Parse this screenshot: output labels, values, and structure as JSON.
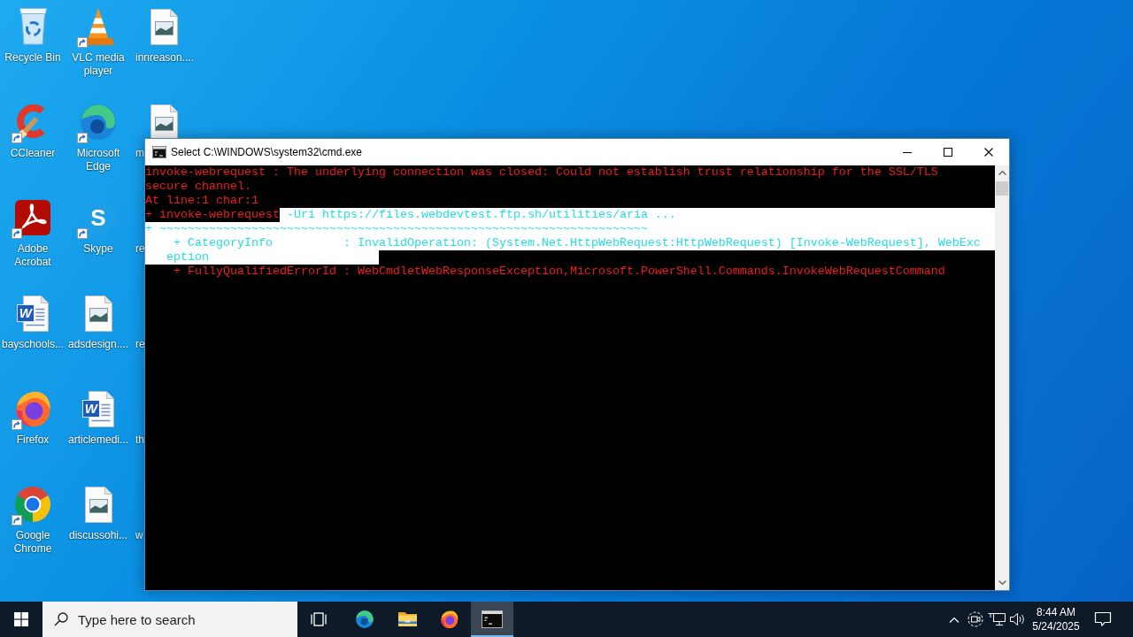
{
  "desktop_columns": [
    {
      "icons": [
        {
          "label": "Recycle Bin",
          "kind": "recycle-bin",
          "shortcut": false
        },
        {
          "label": "CCleaner",
          "kind": "ccleaner",
          "shortcut": true
        },
        {
          "label": "Adobe Acrobat",
          "kind": "acrobat",
          "shortcut": true
        },
        {
          "label": "bayschools...",
          "kind": "word-document",
          "glyph": "W",
          "shortcut": false
        },
        {
          "label": "Firefox",
          "kind": "firefox",
          "shortcut": true
        },
        {
          "label": "Google Chrome",
          "kind": "chrome",
          "shortcut": true
        }
      ]
    },
    {
      "icons": [
        {
          "label": "VLC media player",
          "kind": "vlc",
          "shortcut": true
        },
        {
          "label": "Microsoft Edge",
          "kind": "edge",
          "shortcut": true
        },
        {
          "label": "Skype",
          "kind": "skype",
          "glyph": "S",
          "shortcut": true
        },
        {
          "label": "adsdesign....",
          "kind": "image-file",
          "shortcut": false
        },
        {
          "label": "articlemedi...",
          "kind": "word-document",
          "glyph": "W",
          "shortcut": false
        },
        {
          "label": "discussohi...",
          "kind": "image-file",
          "shortcut": false
        }
      ]
    },
    {
      "icons": [
        {
          "label": "innreason....",
          "kind": "image-file",
          "shortcut": false
        },
        {
          "label": "m",
          "kind": "image-file",
          "shortcut": false
        },
        {
          "label": "re"
        },
        {
          "label": "re"
        },
        {
          "label": "th"
        },
        {
          "label": "w"
        }
      ]
    }
  ],
  "window": {
    "title": "Select C:\\WINDOWS\\system32\\cmd.exe",
    "console": {
      "lines": [
        {
          "segments": [
            {
              "text": "invoke-webrequest : The underlying connection was closed: Could not establish trust relationship for the SSL/TLS",
              "selected": false
            }
          ]
        },
        {
          "segments": [
            {
              "text": "secure channel.",
              "selected": false
            }
          ]
        },
        {
          "segments": [
            {
              "text": "At line:1 char:1",
              "selected": false
            }
          ]
        },
        {
          "segments": [
            {
              "text": "+ invoke-webrequest",
              "selected": false
            },
            {
              "text": " -Uri https://files.webdevtest.ftp.sh/utilities/aria ...",
              "selected": true
            }
          ]
        },
        {
          "segments": [
            {
              "text": "+ ~~~~~~~~~~~~~~~~~~~~~~~~~~~~~~~~~~~~~~~~~~~~~~~~~~~~~~~~~~~~~~~~~~~~~",
              "selected": true
            }
          ]
        },
        {
          "segments": [
            {
              "text": "    + CategoryInfo          : InvalidOperation: (System.Net.HttpWebRequest:HttpWebRequest) [Invoke-WebRequest], WebExc",
              "selected": true
            }
          ]
        },
        {
          "segments": [
            {
              "text": "   eption                        ",
              "selected": true
            }
          ]
        },
        {
          "segments": [
            {
              "text": "    + FullyQualifiedErrorId : WebCmdletWebResponseException,Microsoft.PowerShell.Commands.InvokeWebRequestCommand",
              "selected": false
            }
          ]
        }
      ]
    }
  },
  "taskbar": {
    "search": {
      "placeholder": "Type here to search"
    },
    "pinned": [
      {
        "kind": "edge",
        "selected": false
      },
      {
        "kind": "file-explorer",
        "selected": false
      },
      {
        "kind": "firefox",
        "selected": false
      },
      {
        "kind": "terminal",
        "selected": true
      }
    ],
    "clock": {
      "time": "8:44 AM",
      "date": "5/24/2025"
    }
  }
}
